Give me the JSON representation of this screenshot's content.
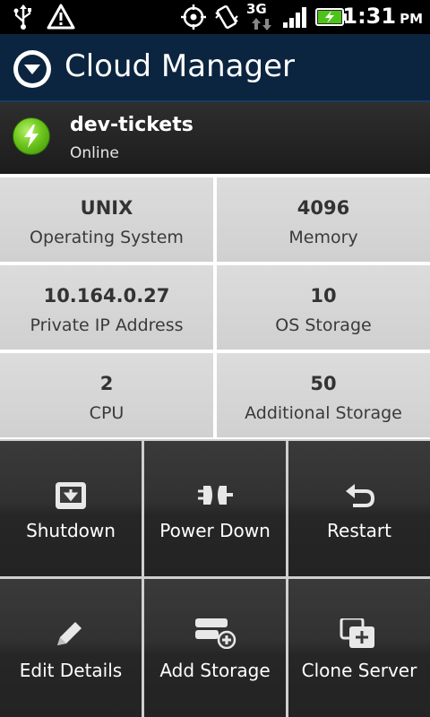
{
  "status_bar": {
    "network": "3G",
    "time": "1:31",
    "ampm": "PM"
  },
  "header": {
    "title": "Cloud Manager"
  },
  "server": {
    "name": "dev-tickets",
    "status": "Online"
  },
  "info": [
    {
      "value": "UNIX",
      "label": "Operating System"
    },
    {
      "value": "4096",
      "label": "Memory"
    },
    {
      "value": "10.164.0.27",
      "label": "Private IP Address"
    },
    {
      "value": "10",
      "label": "OS Storage"
    },
    {
      "value": "2",
      "label": "CPU"
    },
    {
      "value": "50",
      "label": "Additional Storage"
    }
  ],
  "actions": [
    {
      "label": "Shutdown",
      "icon": "shutdown-icon"
    },
    {
      "label": "Power Down",
      "icon": "power-plug-icon"
    },
    {
      "label": "Restart",
      "icon": "restart-icon"
    },
    {
      "label": "Edit Details",
      "icon": "pencil-icon"
    },
    {
      "label": "Add Storage",
      "icon": "add-storage-icon"
    },
    {
      "label": "Clone Server",
      "icon": "clone-icon"
    }
  ]
}
